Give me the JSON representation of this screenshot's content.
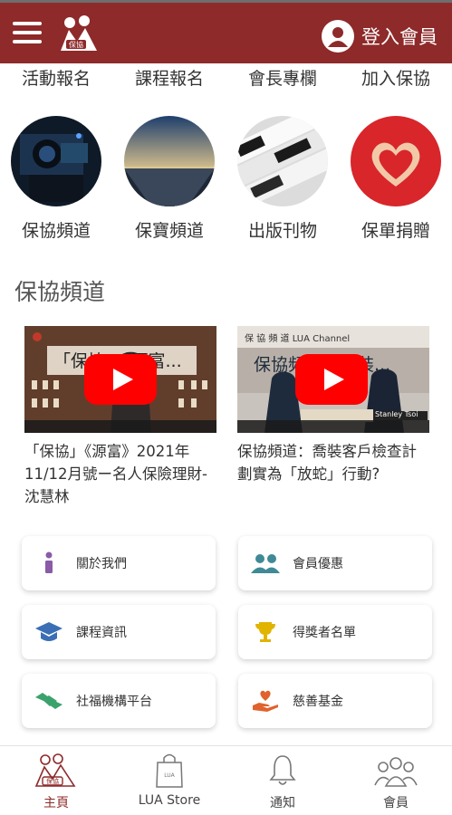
{
  "header": {
    "login_label": "登入會員",
    "logo_text": "保協",
    "bg_color": "#8e2a2a"
  },
  "quick_links": [
    {
      "label": "活動報名"
    },
    {
      "label": "課程報名"
    },
    {
      "label": "會長專欄"
    },
    {
      "label": "加入保協"
    }
  ],
  "circle_links": [
    {
      "label": "保協頻道",
      "icon": "camera-image"
    },
    {
      "label": "保寶頻道",
      "icon": "sunset-image"
    },
    {
      "label": "出版刊物",
      "icon": "newspaper-image"
    },
    {
      "label": "保單捐贈",
      "icon": "heart-hands-image"
    }
  ],
  "channel_section": {
    "title": "保協頻道",
    "videos": [
      {
        "title": "「保協」《源富》2021年11/12月號ー名人保險理財- 沈慧林",
        "thumb_text": "「保協」《源富..."
      },
      {
        "title": "保協頻道：喬裝客戶檢查計劃實為「放蛇」行動?",
        "thumb_text": "保協頻道：喬裝...",
        "thumb_banner": "保 協 頻 道 LUA Channel",
        "thumb_name": "Stanley Tsoi"
      }
    ]
  },
  "menu_cards": [
    {
      "label": "關於我們",
      "icon": "info-icon",
      "color": "#8a5ba6"
    },
    {
      "label": "會員優惠",
      "icon": "members-icon",
      "color": "#3f8a96"
    },
    {
      "label": "課程資訊",
      "icon": "graduation-cap-icon",
      "color": "#3a6fb5"
    },
    {
      "label": "得獎者名單",
      "icon": "trophy-icon",
      "color": "#e1b400"
    },
    {
      "label": "社福機構平台",
      "icon": "handshake-icon",
      "color": "#3aa36b"
    },
    {
      "label": "慈善基金",
      "icon": "charity-heart-icon",
      "color": "#e0622c"
    }
  ],
  "bottom_nav": [
    {
      "label": "主頁",
      "icon": "home-logo-icon",
      "active": true
    },
    {
      "label": "LUA Store",
      "icon": "shopping-bag-icon",
      "bag_text": "LUA",
      "active": false
    },
    {
      "label": "通知",
      "icon": "bell-icon",
      "active": false
    },
    {
      "label": "會員",
      "icon": "group-icon",
      "active": false
    }
  ]
}
